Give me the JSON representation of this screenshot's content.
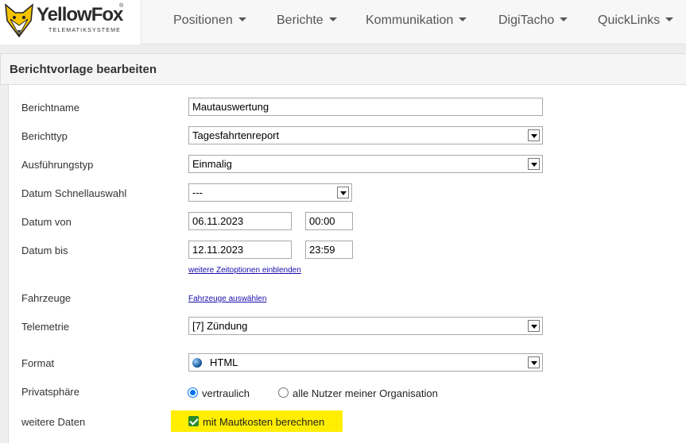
{
  "brand": {
    "name": "YellowFox",
    "registered": "®",
    "tagline": "TELEMATIKSYSTEME"
  },
  "nav": {
    "items": [
      {
        "label": "Positionen"
      },
      {
        "label": "Berichte"
      },
      {
        "label": "Kommunikation"
      },
      {
        "label": "DigiTacho"
      },
      {
        "label": "QuickLinks"
      }
    ]
  },
  "panel": {
    "title": "Berichtvorlage bearbeiten"
  },
  "form": {
    "report_name": {
      "label": "Berichtname",
      "value": "Mautauswertung"
    },
    "report_type": {
      "label": "Berichttyp",
      "value": "Tagesfahrtenreport"
    },
    "execution_type": {
      "label": "Ausführungstyp",
      "value": "Einmalig"
    },
    "date_quick": {
      "label": "Datum Schnellauswahl",
      "value": "---"
    },
    "date_from": {
      "label": "Datum von",
      "date": "06.11.2023",
      "time": "00:00"
    },
    "date_to": {
      "label": "Datum bis",
      "date": "12.11.2023",
      "time": "23:59"
    },
    "more_time_options": "weitere Zeitoptionen einblenden",
    "vehicles": {
      "label": "Fahrzeuge",
      "link": "Fahrzeuge auswählen"
    },
    "telemetry": {
      "label": "Telemetrie",
      "value": "[7] Zündung"
    },
    "format": {
      "label": "Format",
      "value": "HTML"
    },
    "privacy": {
      "label": "Privatsphäre",
      "options": [
        {
          "label": "vertraulich",
          "selected": true
        },
        {
          "label": "alle Nutzer meiner Organisation",
          "selected": false
        }
      ]
    },
    "more_data": {
      "label": "weitere Daten",
      "checkbox": "mit Mautkosten berechnen",
      "checked": true
    }
  },
  "colors": {
    "highlight": "#ffee00",
    "checkbox": "#2b8a2b",
    "radio": "#0075ff",
    "link": "#1a0dab",
    "logo_yellow": "#f5c400"
  }
}
